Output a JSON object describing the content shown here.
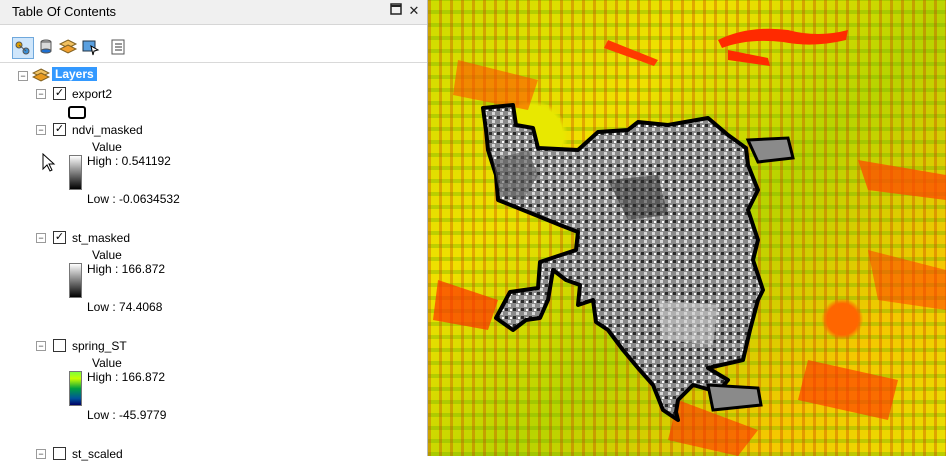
{
  "panel": {
    "title": "Table Of Contents",
    "pin_glyph": "▫",
    "close_glyph": "✕"
  },
  "toolbar": {
    "buttons": [
      {
        "icon": "list-by-drawing-order-icon",
        "active": true
      },
      {
        "icon": "list-by-source-icon",
        "active": false
      },
      {
        "icon": "list-by-visibility-icon",
        "active": false
      },
      {
        "icon": "list-by-selection-icon",
        "active": false
      },
      {
        "icon": "options-icon",
        "active": false
      }
    ]
  },
  "tree": {
    "root_label": "Layers",
    "layers": [
      {
        "name": "export2",
        "checked": true,
        "legend_type": "outline"
      },
      {
        "name": "ndvi_masked",
        "checked": true,
        "legend_type": "gray",
        "value_label": "Value",
        "high": "High : 0.541192",
        "low": "Low : -0.0634532"
      },
      {
        "name": "st_masked",
        "checked": true,
        "legend_type": "gray",
        "value_label": "Value",
        "high": "High : 166.872",
        "low": "Low : 74.4068"
      },
      {
        "name": "spring_ST",
        "checked": false,
        "legend_type": "color",
        "value_label": "Value",
        "high": "High : 166.872",
        "low": "Low : -45.9779"
      },
      {
        "name": "st_scaled",
        "checked": false,
        "legend_type": "none"
      }
    ]
  },
  "colors": {
    "selection_bg": "#3399ff",
    "map_outline": "#000000",
    "urban_gray": "#8a8a8a",
    "hot_red": "#ff2a00",
    "veg_green": "#6bb800",
    "field_yellow": "#f0e000"
  }
}
